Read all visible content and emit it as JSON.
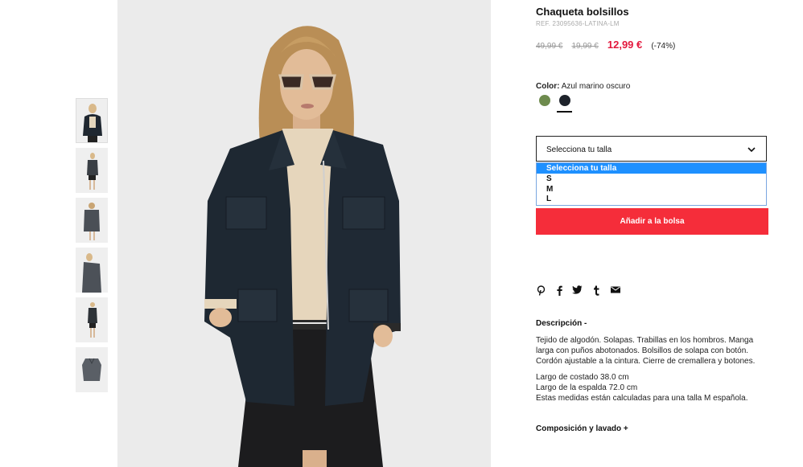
{
  "product": {
    "title": "Chaqueta bolsillos",
    "ref": "REF. 23095636-LATINA-LM",
    "price_original": "49,99 €",
    "price_previous": "19,99 €",
    "price_current": "12,99 €",
    "discount": "(-74%)"
  },
  "color": {
    "label": "Color:",
    "value": "Azul marino oscuro",
    "swatches": [
      {
        "name": "verde",
        "hex": "#6e8b4e"
      },
      {
        "name": "azul marino oscuro",
        "hex": "#1e232b",
        "selected": true
      }
    ]
  },
  "size": {
    "placeholder": "Selecciona tu talla",
    "options": [
      "Selecciona tu talla",
      "S",
      "M",
      "L"
    ],
    "highlighted": "Selecciona tu talla"
  },
  "cart": {
    "add_label": "Añadir a la bolsa",
    "color": "#f52d3a"
  },
  "social": {
    "icons": [
      "pinterest-icon",
      "facebook-icon",
      "twitter-icon",
      "tumblr-icon",
      "email-icon"
    ],
    "glyphs": [
      "℗",
      "f",
      "🐦",
      "t",
      "✉"
    ]
  },
  "description": {
    "heading": "Descripción -",
    "paragraph": "Tejido de algodón. Solapas. Trabillas en los hombros. Manga larga con puños abotonados. Bolsillos de solapa con botón. Cordón ajustable a la cintura. Cierre de cremallera y botones.",
    "measure_1": "Largo de costado 38.0 cm",
    "measure_2": "Largo de la espalda 72.0 cm",
    "measure_3": "Estas medidas están calculadas para una talla M española."
  },
  "composition": {
    "heading": "Composición y lavado +"
  }
}
